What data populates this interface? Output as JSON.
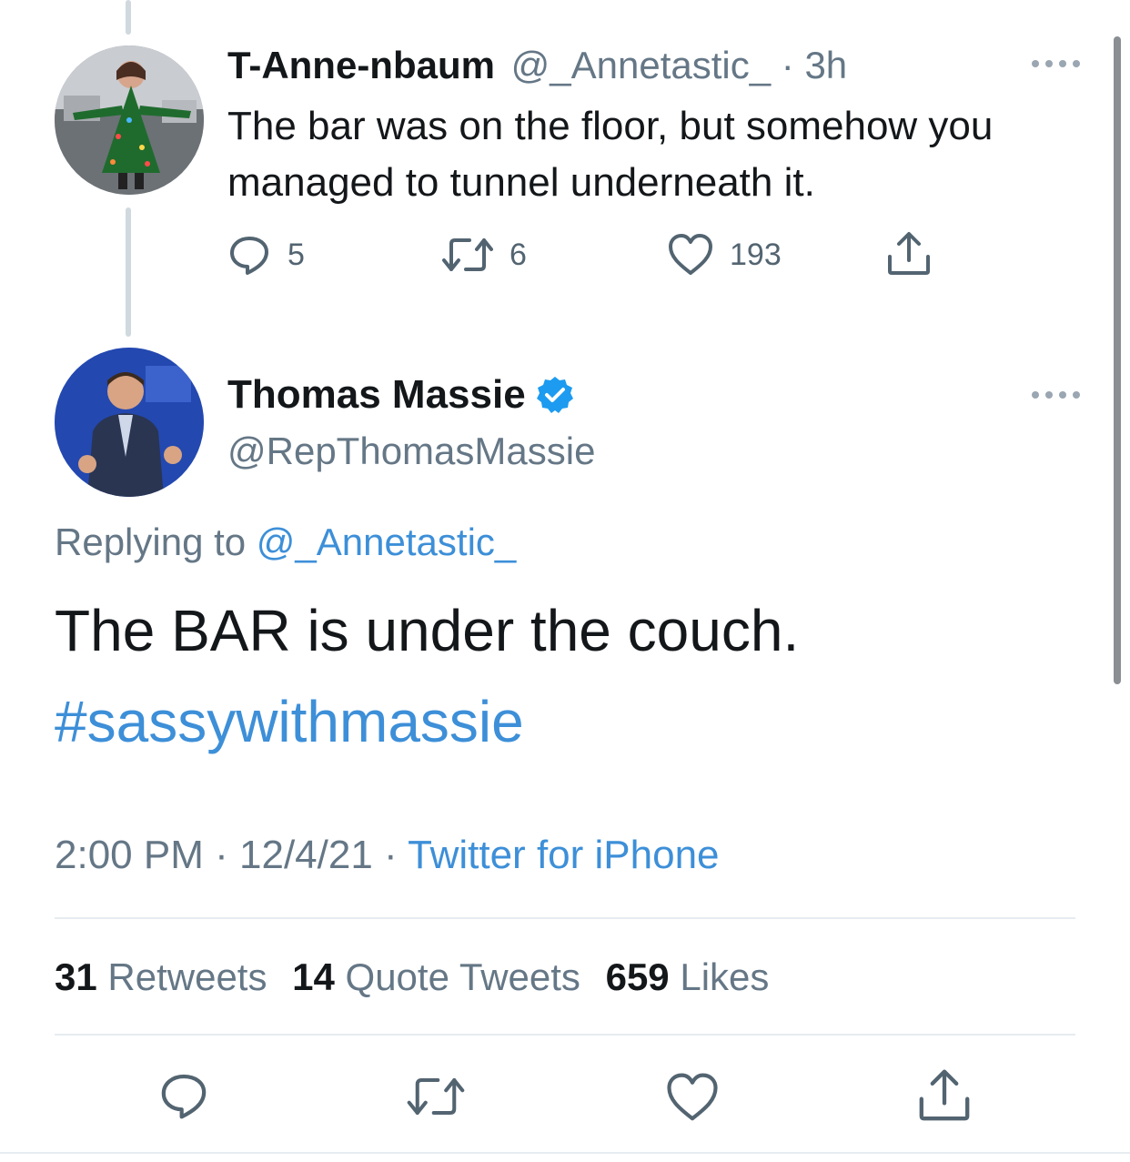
{
  "parent_tweet": {
    "display_name": "T-Anne-nbaum",
    "handle": "@_Annetastic_",
    "time": "· 3h",
    "text": "The bar was on the floor, but somehow you managed to tunnel underneath it.",
    "reply_count": "5",
    "retweet_count": "6",
    "like_count": "193",
    "avatar_icon": "user-avatar-christmas-tree-dress"
  },
  "main_tweet": {
    "display_name": "Thomas Massie",
    "verified_icon": "verified-badge-icon",
    "handle": "@RepThomasMassie",
    "replying_to_label": "Replying to",
    "replying_to_handle": "@_Annetastic_",
    "text": "The BAR is under the couch.",
    "hashtag": "#sassywithmassie",
    "time": "2:00 PM",
    "date": "12/4/21",
    "separator": "·",
    "source": "Twitter for iPhone",
    "avatar_icon": "user-avatar-speaker-on-stage"
  },
  "stats": {
    "retweets_count": "31",
    "retweets_label": "Retweets",
    "quotes_count": "14",
    "quotes_label": "Quote Tweets",
    "likes_count": "659",
    "likes_label": "Likes"
  },
  "icons": [
    "reply-icon",
    "retweet-icon",
    "like-icon",
    "share-icon",
    "more-icon"
  ],
  "colors": {
    "link_blue": "#3d8fd8",
    "secondary_text": "#657786",
    "primary_text": "#14171a",
    "verified_blue": "#1d9bf0"
  }
}
